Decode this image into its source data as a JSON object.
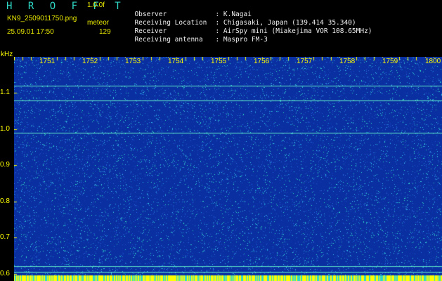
{
  "header": {
    "brand": "H R O F F T",
    "version": "1.0.0f",
    "filename": "KN9_2509011750.png",
    "meteor_label": "meteor",
    "datetime": "25.09.01 17:50",
    "count": "129"
  },
  "info": [
    {
      "key": "Observer",
      "value": ": K.Nagai"
    },
    {
      "key": "Receiving Location",
      "value": ": Chigasaki, Japan (139.414 35.340)"
    },
    {
      "key": "Receiver",
      "value": ": AirSpy mini (Miakejima VOR 108.65MHz)"
    },
    {
      "key": "Receiving antenna",
      "value": ": Maspro FM-3"
    }
  ],
  "chart_data": {
    "type": "heatmap",
    "ylabel": "kHz",
    "y_ticks": [
      "1.1",
      "1.0",
      "0.9",
      "0.8",
      "0.7",
      "0.6"
    ],
    "y_tick_values": [
      1.1,
      1.0,
      0.9,
      0.8,
      0.7,
      0.6
    ],
    "ylim": [
      0.58,
      1.2
    ],
    "x_ticks": [
      "1751",
      "1752",
      "1753",
      "1754",
      "1755",
      "1756",
      "1757",
      "1758",
      "1759",
      "1800"
    ],
    "x_tick_values": [
      1751,
      1752,
      1753,
      1754,
      1755,
      1756,
      1757,
      1758,
      1759,
      1800
    ],
    "xlim": [
      1750,
      1800
    ],
    "horizontal_lines_khz": [
      1.12,
      1.08,
      0.99,
      0.62,
      0.605
    ],
    "colors": {
      "background": "#0a2fa0",
      "noise": "#2fd9c6",
      "axis": "#ffff00"
    }
  }
}
